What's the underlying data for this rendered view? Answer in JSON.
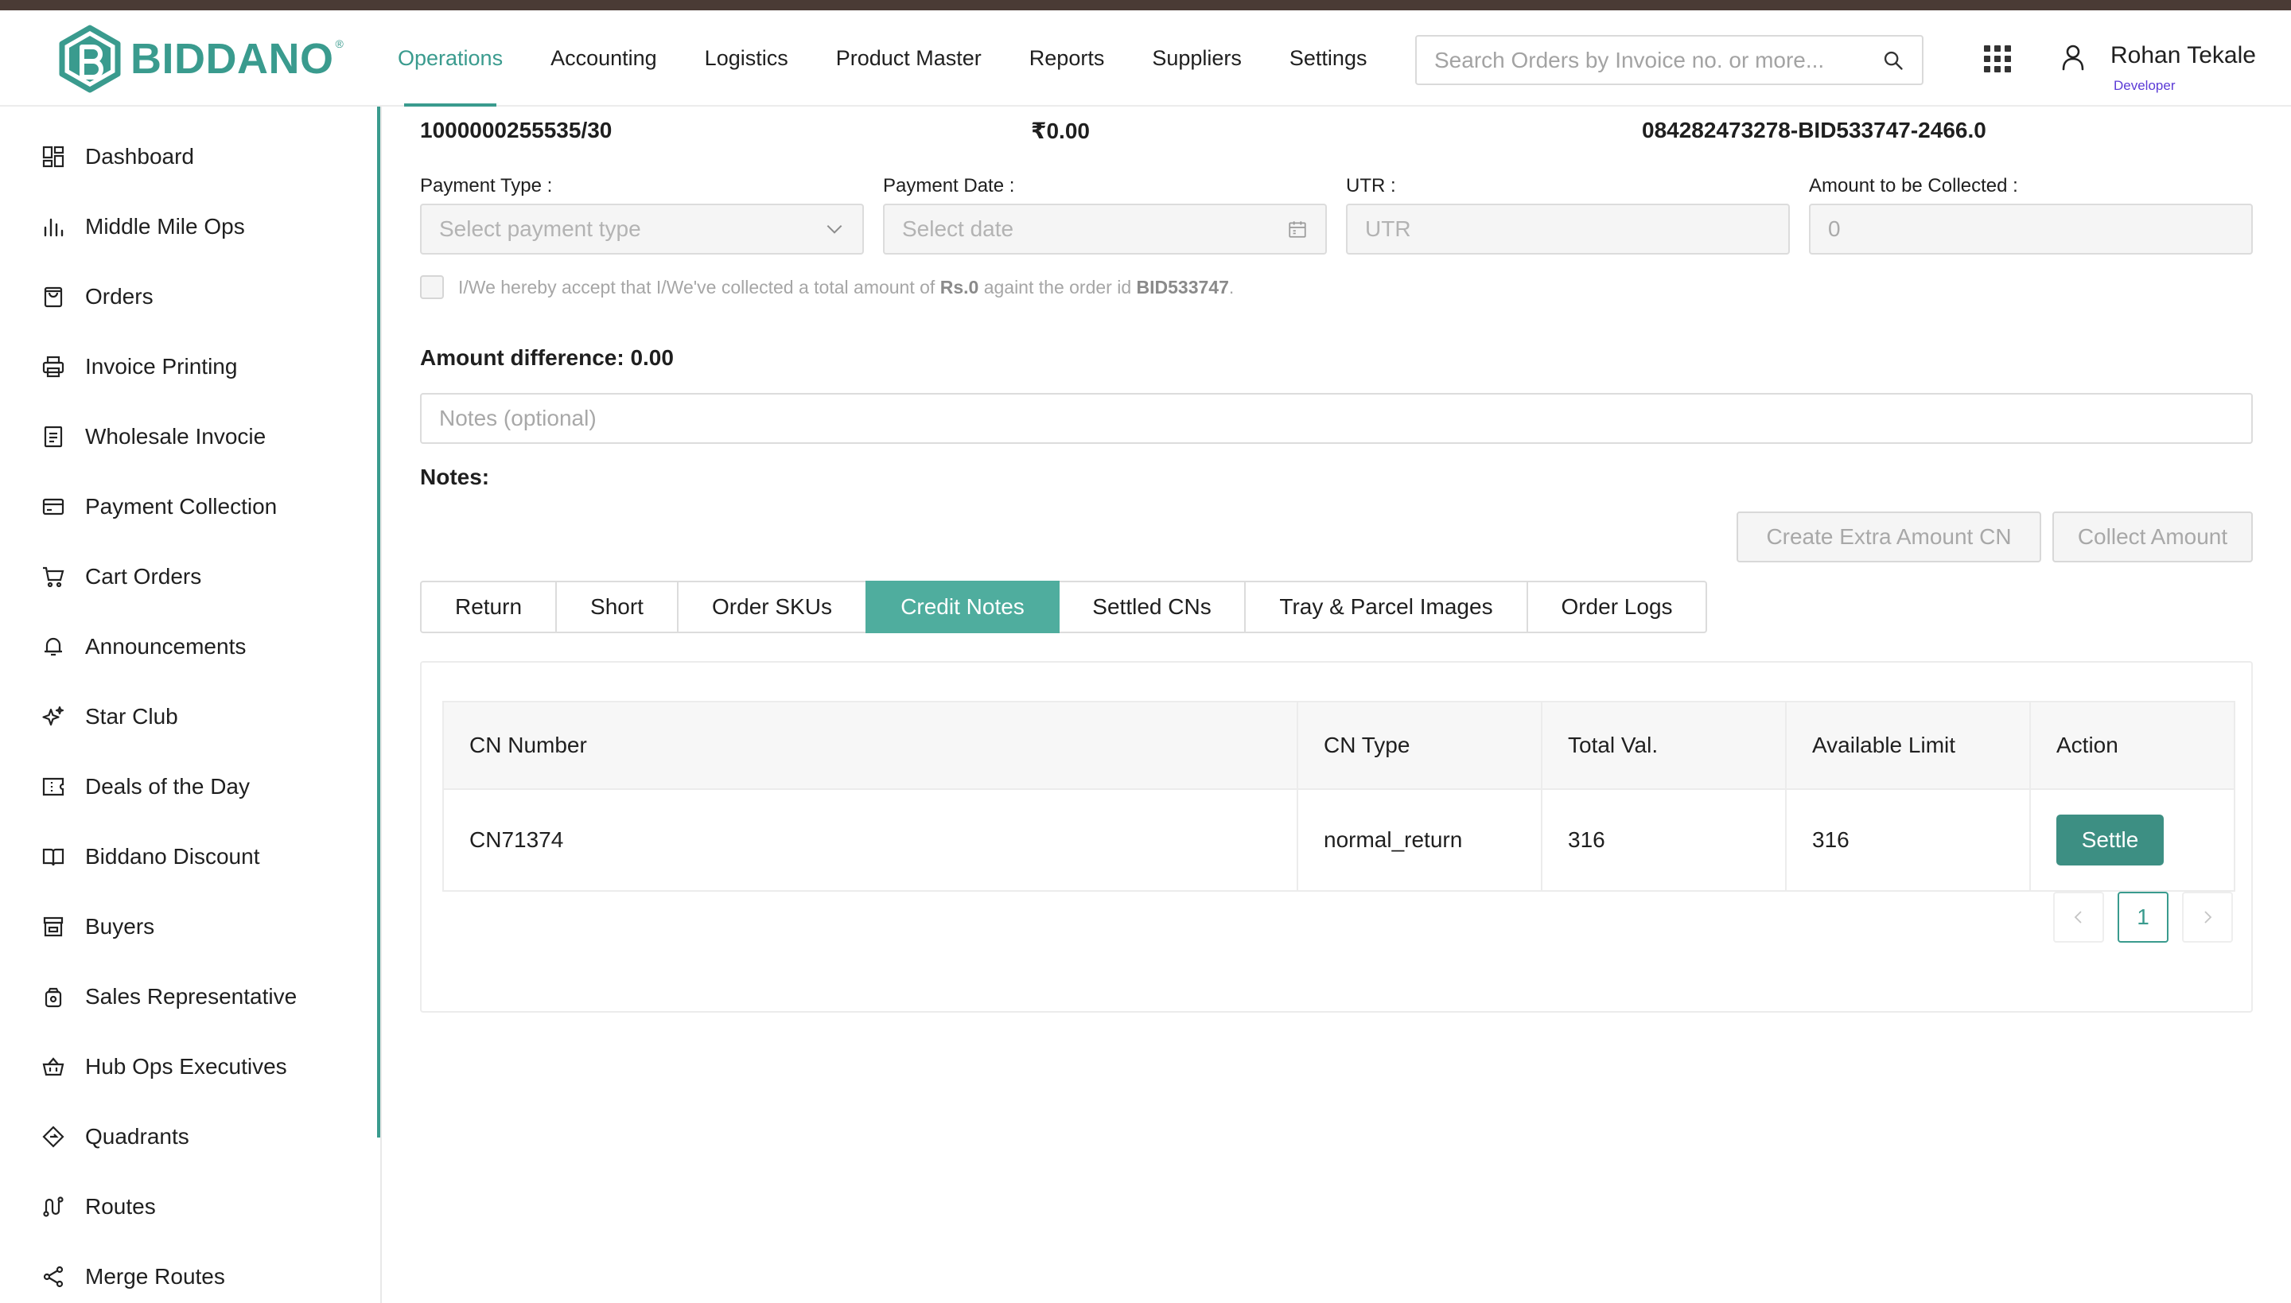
{
  "header": {
    "logo_text": "BIDDANO",
    "logo_reg": "®",
    "nav": [
      {
        "label": "Operations",
        "active": true
      },
      {
        "label": "Accounting"
      },
      {
        "label": "Logistics"
      },
      {
        "label": "Product Master"
      },
      {
        "label": "Reports"
      },
      {
        "label": "Suppliers"
      },
      {
        "label": "Settings"
      }
    ],
    "search_placeholder": "Search Orders by Invoice no. or more...",
    "user_name": "Rohan Tekale",
    "user_role": "Developer"
  },
  "sidebar": {
    "items": [
      {
        "label": "Dashboard",
        "icon": "dashboard-icon"
      },
      {
        "label": "Middle Mile Ops",
        "icon": "bar-chart-icon"
      },
      {
        "label": "Orders",
        "icon": "shopping-bag-icon"
      },
      {
        "label": "Invoice Printing",
        "icon": "printer-icon"
      },
      {
        "label": "Wholesale Invocie",
        "icon": "document-icon"
      },
      {
        "label": "Payment Collection",
        "icon": "card-icon"
      },
      {
        "label": "Cart Orders",
        "icon": "cart-icon"
      },
      {
        "label": "Announcements",
        "icon": "bell-icon"
      },
      {
        "label": "Star Club",
        "icon": "sparkle-icon"
      },
      {
        "label": "Deals of the Day",
        "icon": "ticket-icon"
      },
      {
        "label": "Biddano Discount",
        "icon": "book-icon"
      },
      {
        "label": "Buyers",
        "icon": "store-icon"
      },
      {
        "label": "Sales Representative",
        "icon": "briefcase-icon"
      },
      {
        "label": "Hub Ops Executives",
        "icon": "basket-icon"
      },
      {
        "label": "Quadrants",
        "icon": "diamond-icon"
      },
      {
        "label": "Routes",
        "icon": "route-icon"
      },
      {
        "label": "Merge Routes",
        "icon": "share-icon"
      }
    ]
  },
  "summary": {
    "invoice": "1000000255535/30",
    "amount": "₹0.00",
    "reference": "084282473278-BID533747-2466.0"
  },
  "payment": {
    "type_label": "Payment Type :",
    "type_placeholder": "Select payment type",
    "date_label": "Payment Date :",
    "date_placeholder": "Select date",
    "utr_label": "UTR :",
    "utr_placeholder": "UTR",
    "amount_label": "Amount to be Collected :",
    "amount_value": "0",
    "accept_pre": "I/We hereby accept that I/We've collected a total amount of ",
    "accept_amount": "Rs.0",
    "accept_mid": " againt the order id ",
    "accept_order": "BID533747",
    "accept_post": "."
  },
  "amount_difference": "Amount difference: 0.00",
  "notes_placeholder": "Notes (optional)",
  "notes_label": "Notes:",
  "actions": {
    "create_cn": "Create Extra Amount CN",
    "collect": "Collect Amount"
  },
  "tabs": [
    {
      "label": "Return"
    },
    {
      "label": "Short"
    },
    {
      "label": "Order SKUs"
    },
    {
      "label": "Credit Notes",
      "active": true
    },
    {
      "label": "Settled CNs"
    },
    {
      "label": "Tray & Parcel Images"
    },
    {
      "label": "Order Logs"
    }
  ],
  "table": {
    "columns": [
      "CN Number",
      "CN Type",
      "Total Val.",
      "Available Limit",
      "Action"
    ],
    "rows": [
      {
        "cn_number": "CN71374",
        "cn_type": "normal_return",
        "total": "316",
        "limit": "316",
        "action": "Settle"
      }
    ]
  },
  "pagination": {
    "current": "1"
  },
  "colors": {
    "accent": "#3a9b8e",
    "tab_active": "#4fad9e",
    "settle": "#3d8f83",
    "role": "#5b3bd6"
  }
}
